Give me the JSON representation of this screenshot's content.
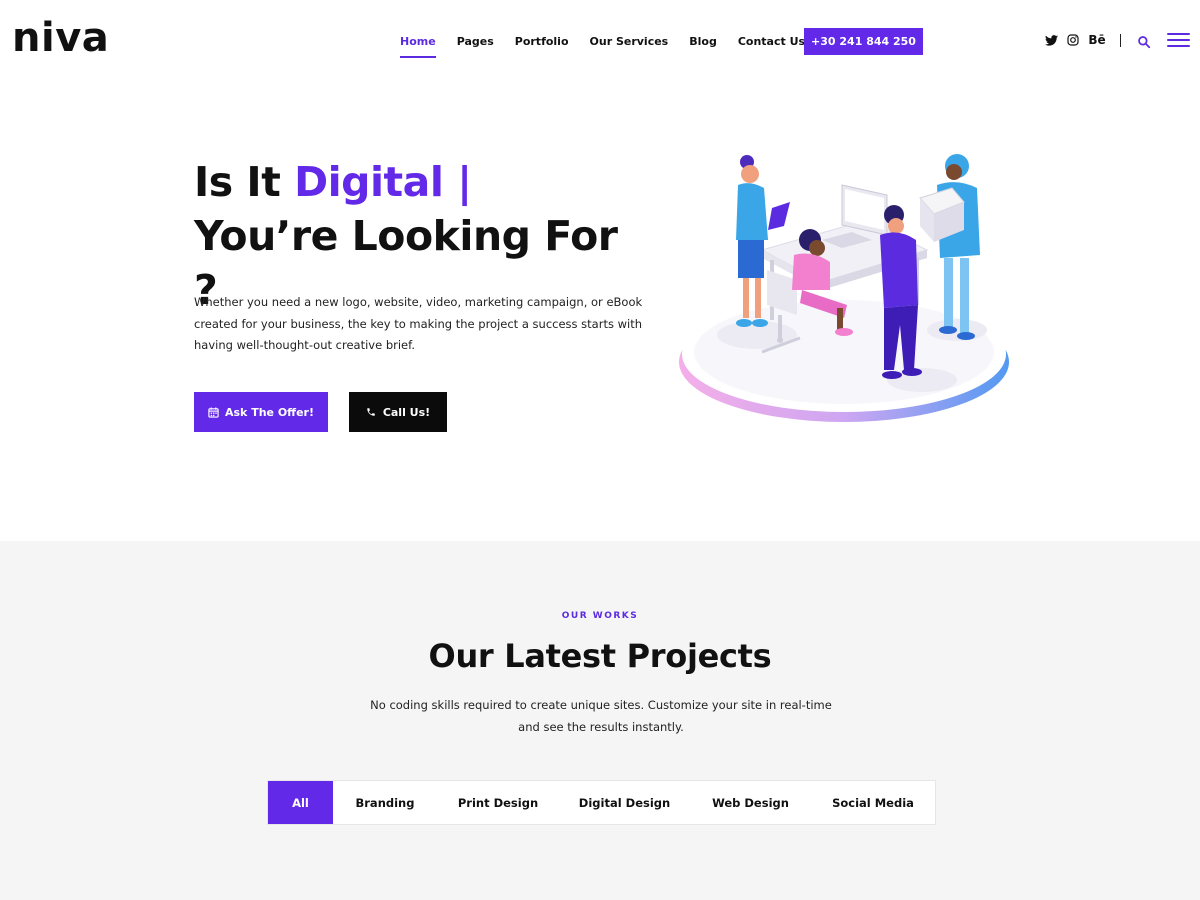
{
  "brand": {
    "logo_text": "niva"
  },
  "nav": {
    "items": [
      {
        "label": "Home",
        "active": true
      },
      {
        "label": "Pages",
        "active": false
      },
      {
        "label": "Portfolio",
        "active": false
      },
      {
        "label": "Our Services",
        "active": false
      },
      {
        "label": "Blog",
        "active": false
      },
      {
        "label": "Contact Us",
        "active": false
      }
    ],
    "phone_label": "+30 241 844 250"
  },
  "social": {
    "icons": [
      "twitter-icon",
      "instagram-icon",
      "behance-icon"
    ],
    "behance_label": "Bē"
  },
  "hero": {
    "title_prefix": "Is It ",
    "title_accent": "Digital |",
    "title_line2": "You’re Looking For ?",
    "description": "Whether you need a new logo, website, video, marketing campaign, or eBook created for your business, the key to making the project a success starts with having well-thought-out creative brief.",
    "offer_button": "Ask The Offer!",
    "call_button": "Call Us!"
  },
  "works": {
    "tag": "OUR WORKS",
    "title": "Our Latest Projects",
    "description": "No coding skills required to create unique sites. Customize your site in real-time and see the results instantly.",
    "filters": [
      {
        "label": "All",
        "active": true
      },
      {
        "label": "Branding",
        "active": false
      },
      {
        "label": "Print Design",
        "active": false
      },
      {
        "label": "Digital Design",
        "active": false
      },
      {
        "label": "Web Design",
        "active": false
      },
      {
        "label": "Social Media",
        "active": false
      }
    ]
  },
  "colors": {
    "accent": "#6329e8",
    "dark_button": "#0b0b0b",
    "section_bg": "#f5f5f6"
  }
}
